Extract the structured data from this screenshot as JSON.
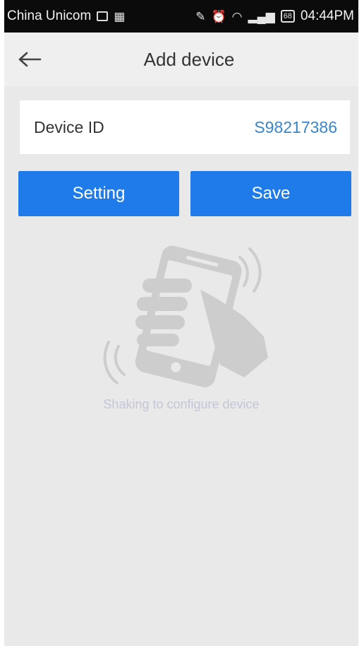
{
  "status_bar": {
    "carrier": "China Unicom",
    "time": "04:44PM",
    "battery_label": "68",
    "icons": [
      "image-icon",
      "notification-icon",
      "mute-icon",
      "alarm-icon",
      "wifi-icon",
      "signal-icon",
      "battery-icon"
    ]
  },
  "header": {
    "title": "Add device",
    "back_icon": "back-arrow-icon"
  },
  "device": {
    "label": "Device ID",
    "value": "S98217386"
  },
  "actions": {
    "setting_label": "Setting",
    "save_label": "Save"
  },
  "illustration": {
    "icon": "shake-phone-icon",
    "hint": "Shaking to configure device"
  },
  "colors": {
    "accent": "#1f7bea",
    "device_value": "#3a86c8",
    "background": "#e9e9e9",
    "status_bar": "#0b0b0b"
  }
}
